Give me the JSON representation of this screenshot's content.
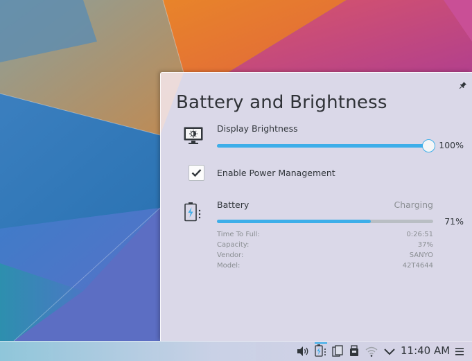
{
  "popup": {
    "title": "Battery and Brightness",
    "brightness": {
      "label": "Display Brightness",
      "value_text": "100%",
      "level": 1.0
    },
    "power_management": {
      "label": "Enable Power Management",
      "checked": true
    },
    "battery": {
      "label": "Battery",
      "status": "Charging",
      "value_text": "71%",
      "level": 0.71,
      "details": [
        {
          "key": "Time To Full:",
          "value": "0:26:51"
        },
        {
          "key": "Capacity:",
          "value": "37%"
        },
        {
          "key": "Vendor:",
          "value": "SANYO"
        },
        {
          "key": "Model:",
          "value": "42T4644"
        }
      ]
    }
  },
  "taskbar": {
    "clock": "11:40 AM",
    "tray_icons": [
      "volume-icon",
      "battery-icon",
      "clipboard-icon",
      "device-notifier-icon",
      "network-wifi-icon",
      "expand-tray-icon",
      "menu-icon"
    ]
  },
  "colors": {
    "accent": "#3daee9",
    "text": "#31363b",
    "muted": "#8a8e92"
  }
}
